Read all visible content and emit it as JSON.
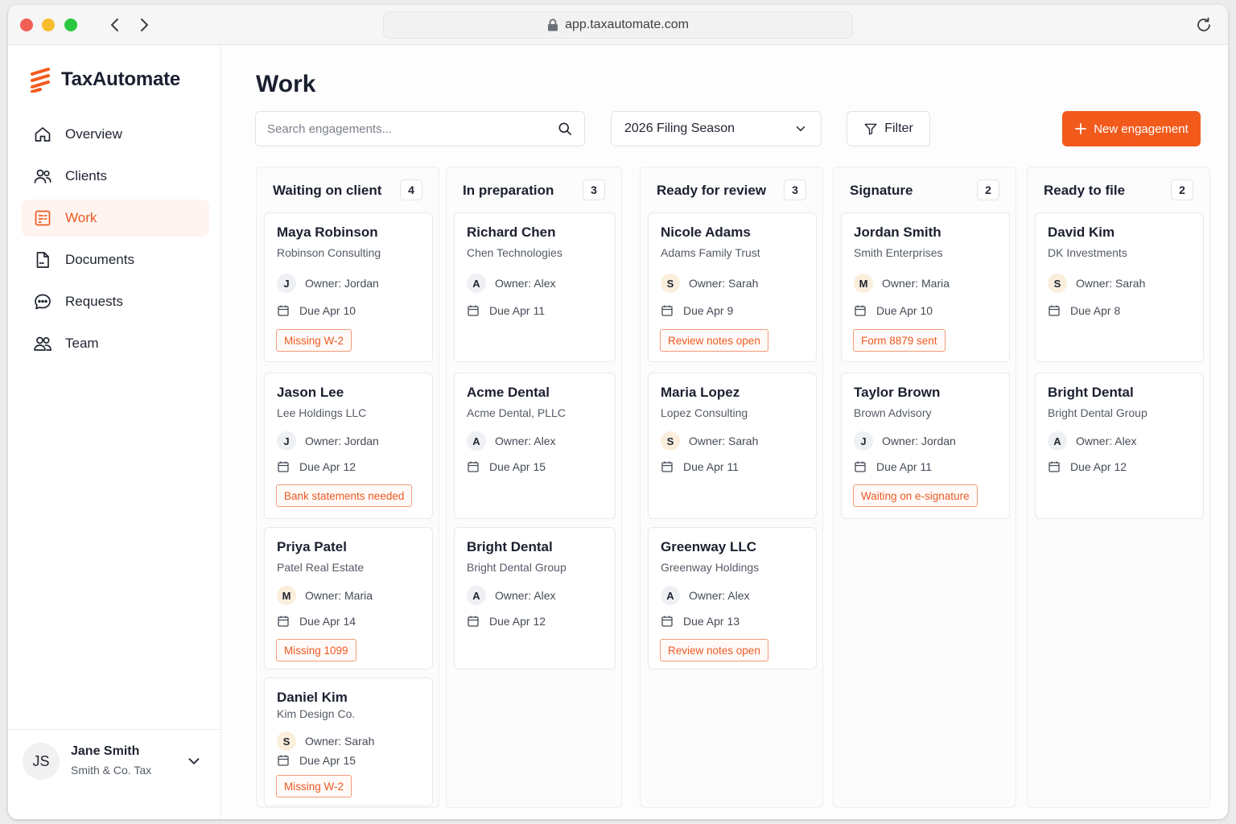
{
  "browser": {
    "url": "app.taxautomate.com"
  },
  "brand": {
    "name": "TaxAutomate",
    "accent": "#f25a1c"
  },
  "sidebar": {
    "items": [
      {
        "label": "Overview",
        "icon": "home-icon"
      },
      {
        "label": "Clients",
        "icon": "clients-icon"
      },
      {
        "label": "Work",
        "icon": "work-icon",
        "active": true
      },
      {
        "label": "Documents",
        "icon": "document-icon"
      },
      {
        "label": "Requests",
        "icon": "chat-icon"
      },
      {
        "label": "Team",
        "icon": "team-icon"
      }
    ]
  },
  "user": {
    "initials": "JS",
    "name": "Jane Smith",
    "org": "Smith & Co. Tax"
  },
  "page": {
    "title": "Work"
  },
  "toolbar": {
    "search_placeholder": "Search engagements...",
    "season": "2026 Filing Season",
    "filter_label": "Filter",
    "new_label": "New engagement"
  },
  "board": {
    "columns": [
      {
        "title": "Waiting on client",
        "count": "4",
        "cards": [
          {
            "name": "Maya Robinson",
            "org": "Robinson Consulting",
            "owner_initial": "J",
            "owner": "Owner: Jordan",
            "due": "Due Apr 10",
            "tag": "Missing W-2"
          },
          {
            "name": "Jason Lee",
            "org": "Lee Holdings LLC",
            "owner_initial": "J",
            "owner": "Owner: Jordan",
            "due": "Due Apr 12",
            "tag": "Bank statements needed"
          },
          {
            "name": "Priya Patel",
            "org": "Patel Real Estate",
            "owner_initial": "M",
            "owner": "Owner: Maria",
            "due": "Due Apr 14",
            "tag": "Missing 1099"
          },
          {
            "name": "Daniel Kim",
            "org": "Kim Design Co.",
            "owner_initial": "S",
            "owner": "Owner: Sarah",
            "due": "Due Apr 15",
            "tag": "Missing W-2"
          }
        ]
      },
      {
        "title": "In preparation",
        "count": "3",
        "cards": [
          {
            "name": "Richard Chen",
            "org": "Chen Technologies",
            "owner_initial": "A",
            "owner": "Owner: Alex",
            "due": "Due Apr 11",
            "tag": ""
          },
          {
            "name": "Acme Dental",
            "org": "Acme Dental, PLLC",
            "owner_initial": "A",
            "owner": "Owner: Alex",
            "due": "Due Apr 15",
            "tag": ""
          },
          {
            "name": "Bright Dental",
            "org": "Bright Dental Group",
            "owner_initial": "A",
            "owner": "Owner: Alex",
            "due": "Due Apr 12",
            "tag": ""
          }
        ]
      },
      {
        "title": "Ready for review",
        "count": "3",
        "cards": [
          {
            "name": "Nicole Adams",
            "org": "Adams Family Trust",
            "owner_initial": "S",
            "owner": "Owner: Sarah",
            "due": "Due Apr 9",
            "tag": "Review notes open"
          },
          {
            "name": "Maria Lopez",
            "org": "Lopez Consulting",
            "owner_initial": "S",
            "owner": "Owner: Sarah",
            "due": "Due Apr 11",
            "tag": ""
          },
          {
            "name": "Greenway LLC",
            "org": "Greenway Holdings",
            "owner_initial": "A",
            "owner": "Owner: Alex",
            "due": "Due Apr 13",
            "tag": "Review notes open"
          }
        ]
      },
      {
        "title": "Signature",
        "count": "2",
        "cards": [
          {
            "name": "Jordan Smith",
            "org": "Smith Enterprises",
            "owner_initial": "M",
            "owner": "Owner: Maria",
            "due": "Due Apr 10",
            "tag": "Form 8879 sent"
          },
          {
            "name": "Taylor Brown",
            "org": "Brown Advisory",
            "owner_initial": "J",
            "owner": "Owner: Jordan",
            "due": "Due Apr 11",
            "tag": "Waiting on e-signature"
          }
        ]
      },
      {
        "title": "Ready to file",
        "count": "2",
        "cards": [
          {
            "name": "David Kim",
            "org": "DK Investments",
            "owner_initial": "S",
            "owner": "Owner: Sarah",
            "due": "Due Apr 8",
            "tag": ""
          },
          {
            "name": "Bright Dental",
            "org": "Bright Dental Group",
            "owner_initial": "A",
            "owner": "Owner: Alex",
            "due": "Due Apr 12",
            "tag": ""
          }
        ]
      }
    ]
  }
}
